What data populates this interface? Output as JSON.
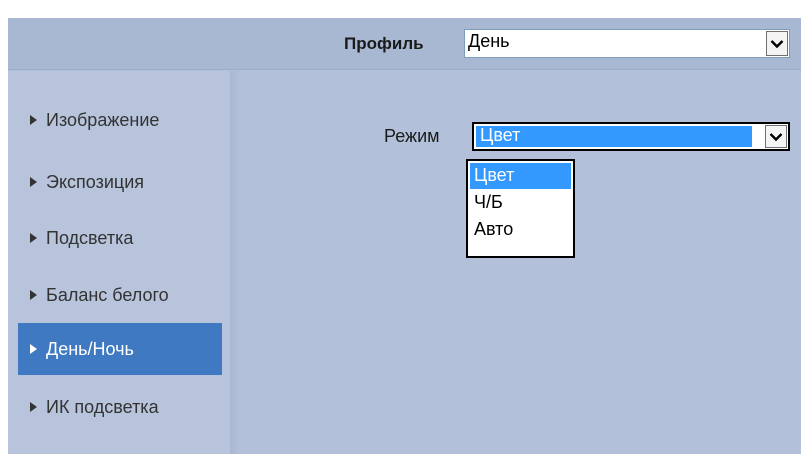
{
  "profile": {
    "label": "Профиль",
    "value": "День"
  },
  "sidebar": {
    "items": [
      {
        "label": "Изображение",
        "active": false
      },
      {
        "label": "Экспозиция",
        "active": false
      },
      {
        "label": "Подсветка",
        "active": false
      },
      {
        "label": "Баланс белого",
        "active": false
      },
      {
        "label": "День/Ночь",
        "active": true
      },
      {
        "label": "ИК подсветка",
        "active": false
      }
    ]
  },
  "mode": {
    "label": "Режим",
    "value": "Цвет",
    "options": [
      "Цвет",
      "Ч/Б",
      "Авто"
    ],
    "selected_index": 0
  },
  "colors": {
    "background": "#b2c0d9",
    "active_item": "#3f79c1",
    "selection": "#3399ff"
  },
  "icons": {
    "nav_arrow": "triangle-right-icon",
    "select_button": "chevron-down-icon"
  }
}
